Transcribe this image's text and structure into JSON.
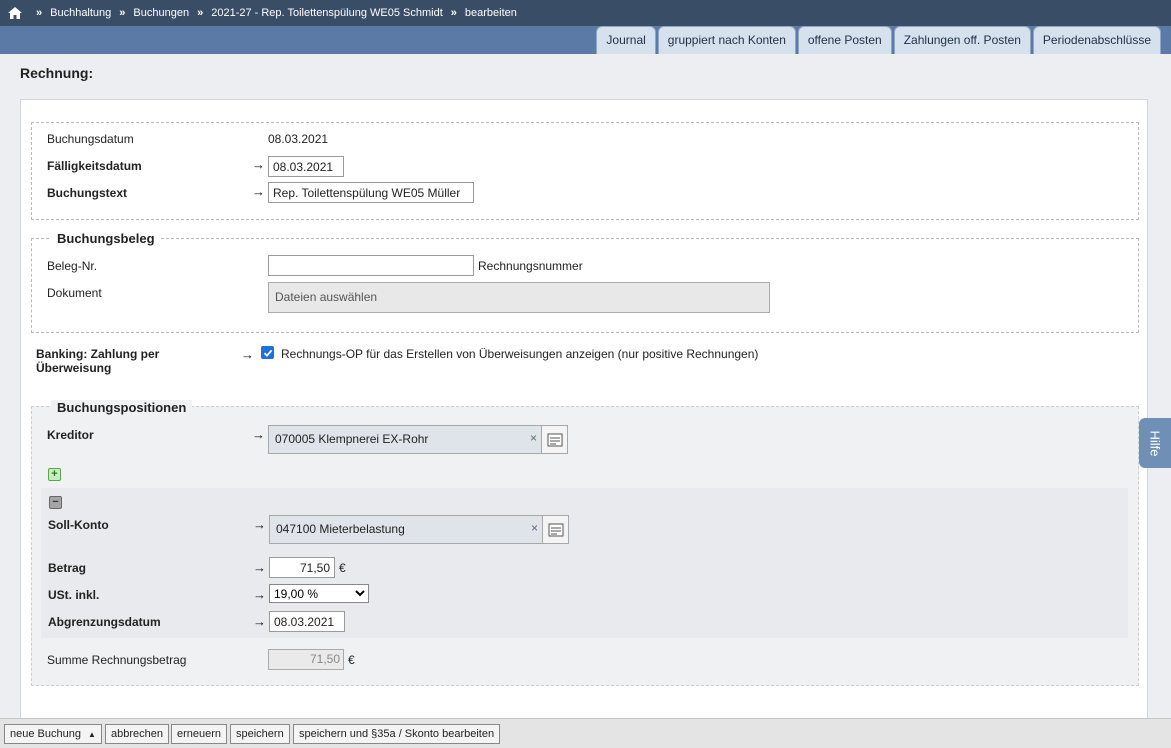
{
  "breadcrumb": {
    "items": [
      "Buchhaltung",
      "Buchungen",
      "2021-27 - Rep. Toilettenspülung WE05 Schmidt",
      "bearbeiten"
    ],
    "separator": "»"
  },
  "tabs": [
    "Journal",
    "gruppiert nach Konten",
    "offene Posten",
    "Zahlungen off. Posten",
    "Periodenabschlüsse"
  ],
  "page_title": "Rechnung:",
  "header_section": {
    "buchungsdatum_label": "Buchungsdatum",
    "buchungsdatum_value": "08.03.2021",
    "faelligkeit_label": "Fälligkeitsdatum",
    "faelligkeit_value": "08.03.2021",
    "buchungstext_label": "Buchungstext",
    "buchungstext_value": "Rep. Toilettenspülung WE05 Müller"
  },
  "beleg": {
    "legend": "Buchungsbeleg",
    "belegnr_label": "Beleg-Nr.",
    "belegnr_value": "",
    "belegnr_hint": "Rechnungsnummer",
    "dokument_label": "Dokument",
    "dokument_button": "Dateien auswählen"
  },
  "banking": {
    "label": "Banking: Zahlung per Überweisung",
    "checked": true,
    "checkbox_label": "Rechnungs-OP für das Erstellen von Überweisungen anzeigen (nur positive Rechnungen)"
  },
  "positionen": {
    "legend": "Buchungspositionen",
    "kreditor_label": "Kreditor",
    "kreditor_value": "070005 Klempnerei EX-Rohr",
    "soll_label": "Soll-Konto",
    "soll_value": "047100 Mieterbelastung",
    "betrag_label": "Betrag",
    "betrag_value": "71,50",
    "currency": "€",
    "ust_label": "USt. inkl.",
    "ust_value": "19,00 %",
    "abgrenzung_label": "Abgrenzungsdatum",
    "abgrenzung_value": "08.03.2021",
    "summe_label": "Summe Rechnungsbetrag",
    "summe_value": "71,50"
  },
  "help_label": "Hilfe",
  "bottom_buttons": {
    "neue_buchung": "neue Buchung",
    "abbrechen": "abbrechen",
    "erneuern": "erneuern",
    "speichern": "speichern",
    "speichern_skonto": "speichern und §35a / Skonto bearbeiten"
  },
  "colors": {
    "breadcrumb_bg": "#3a4d67",
    "tabstrip_bg": "#5b7ba6",
    "tab_bg": "#d6e1ee",
    "help_bg": "#6f8fb6"
  }
}
